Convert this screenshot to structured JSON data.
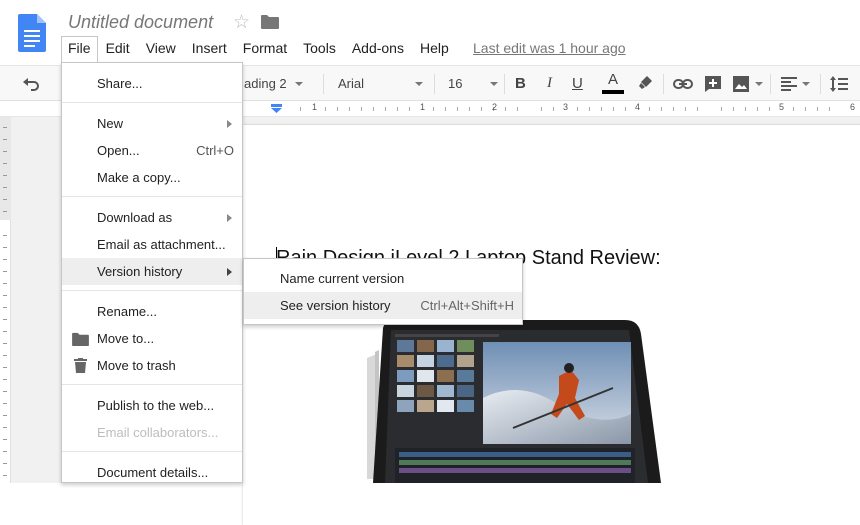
{
  "header": {
    "doc_title": "Untitled document",
    "last_edit": "Last edit was 1 hour ago",
    "menus": [
      "File",
      "Edit",
      "View",
      "Insert",
      "Format",
      "Tools",
      "Add-ons",
      "Help"
    ]
  },
  "toolbar": {
    "style_value": "ading 2",
    "font_value": "Arial",
    "size_value": "16",
    "bold": "B",
    "italic": "I",
    "underline": "U",
    "text_color_glyph": "A",
    "text_color": "#000000"
  },
  "ruler": {
    "numbers": [
      "1",
      "1",
      "2",
      "3",
      "4",
      "5",
      "6"
    ]
  },
  "file_menu": {
    "share": "Share...",
    "new": "New",
    "open": "Open...",
    "open_shortcut": "Ctrl+O",
    "make_copy": "Make a copy...",
    "download_as": "Download as",
    "email_attachment": "Email as attachment...",
    "version_history": "Version history",
    "rename": "Rename...",
    "move_to": "Move to...",
    "move_to_trash": "Move to trash",
    "publish": "Publish to the web...",
    "email_collaborators": "Email collaborators...",
    "document_details": "Document details..."
  },
  "version_submenu": {
    "name_current": "Name current version",
    "see_history": "See version history",
    "see_history_shortcut": "Ctrl+Alt+Shift+H"
  },
  "document": {
    "heading": "Rain Design iLevel 2 Laptop Stand Review:"
  },
  "icons": {
    "logo": "docs-logo-icon",
    "star": "star-icon",
    "folder": "folder-icon",
    "undo": "undo-icon",
    "link": "link-icon",
    "comment": "add-comment-icon",
    "image": "image-icon",
    "align": "align-left-icon",
    "spacing": "line-spacing-icon",
    "highlight": "highlighter-icon",
    "trash": "trash-icon"
  },
  "colors": {
    "brand_blue": "#4285f4",
    "menu_highlight": "#eeeeee"
  }
}
